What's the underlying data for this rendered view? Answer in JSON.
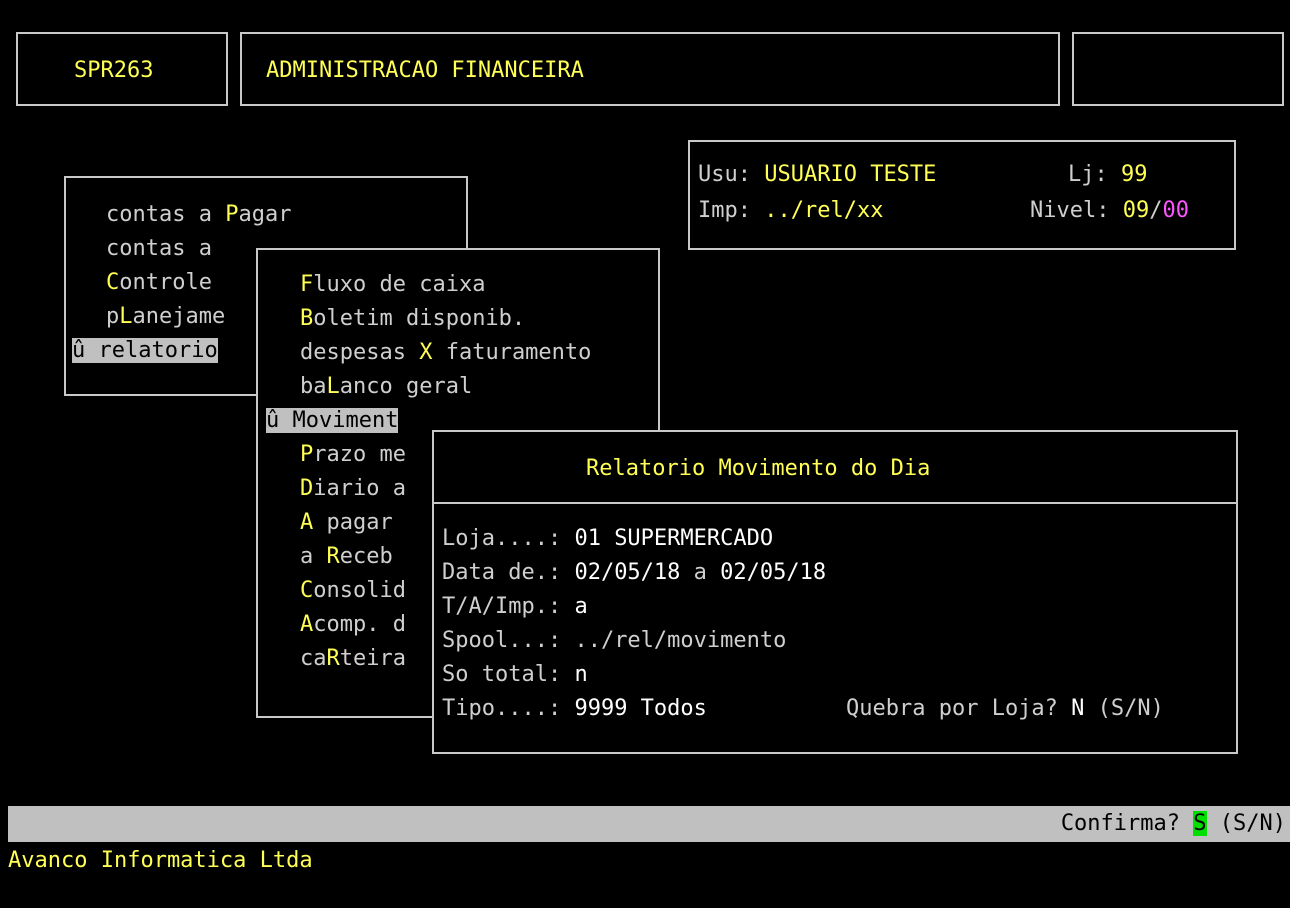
{
  "header": {
    "program_code": "SPR263",
    "system_title": "ADMINISTRACAO FINANCEIRA"
  },
  "user_info": {
    "user_label": "Usu:",
    "user_value": "USUARIO TESTE",
    "store_label": "Lj:",
    "store_value": "99",
    "printer_label": "Imp:",
    "printer_value": "../rel/xx",
    "level_label": "Nivel:",
    "level_value_a": "09",
    "level_sep": "/",
    "level_value_b": "00"
  },
  "main_menu": {
    "items": [
      {
        "pre": "contas a ",
        "hot": "P",
        "post": "agar"
      },
      {
        "pre": "contas a",
        "hot": "",
        "post": ""
      },
      {
        "pre": "",
        "hot": "C",
        "post": "ontrole"
      },
      {
        "pre": "p",
        "hot": "L",
        "post": "anejame"
      },
      {
        "pre": "û relatorio",
        "hot": "",
        "post": ""
      }
    ]
  },
  "sub_menu": {
    "items": [
      {
        "pre": "",
        "hot": "F",
        "post": "luxo de caixa"
      },
      {
        "pre": "",
        "hot": "B",
        "post": "oletim disponib."
      },
      {
        "pre": "despesas ",
        "hot": "X",
        "post": " faturamento"
      },
      {
        "pre": "ba",
        "hot": "L",
        "post": "anco geral"
      },
      {
        "pre": "û Moviment",
        "hot": "",
        "post": ""
      },
      {
        "pre": "",
        "hot": "P",
        "post": "razo me"
      },
      {
        "pre": "",
        "hot": "D",
        "post": "iario a"
      },
      {
        "pre": "",
        "hot": "A",
        "post": " pagar"
      },
      {
        "pre": "a ",
        "hot": "R",
        "post": "eceb"
      },
      {
        "pre": "",
        "hot": "C",
        "post": "onsolid"
      },
      {
        "pre": "",
        "hot": "A",
        "post": "comp. d"
      },
      {
        "pre": "ca",
        "hot": "R",
        "post": "teira"
      }
    ]
  },
  "report_dialog": {
    "title": "Relatorio Movimento do Dia",
    "loja_label": "Loja....: ",
    "loja_value": "01 SUPERMERCADO",
    "data_label": "Data de.: ",
    "data_from": "02/05/18",
    "data_sep": " a ",
    "data_to": "02/05/18",
    "ta_label": "T/A/Imp.: ",
    "ta_value": "a",
    "spool_label": "Spool...: ",
    "spool_value": "../rel/movimento",
    "total_label": "So total: ",
    "total_value": "n",
    "quebra_label": "Quebra por Loja? ",
    "quebra_value": "N",
    "quebra_hint": " (S/N)",
    "tipo_label": "Tipo....: ",
    "tipo_value": "9999 Todos"
  },
  "status_bar": {
    "prompt": "Confirma? ",
    "answer": "S",
    "hint": " (S/N)"
  },
  "footer": {
    "company": "Avanco Informatica Ltda"
  },
  "colors": {
    "background": "#000000",
    "text": "#cfcfcf",
    "highlight": "#ffff55",
    "magenta": "#ff55ff",
    "status_bar": "#c0c0c0",
    "confirm_green": "#00e000"
  }
}
